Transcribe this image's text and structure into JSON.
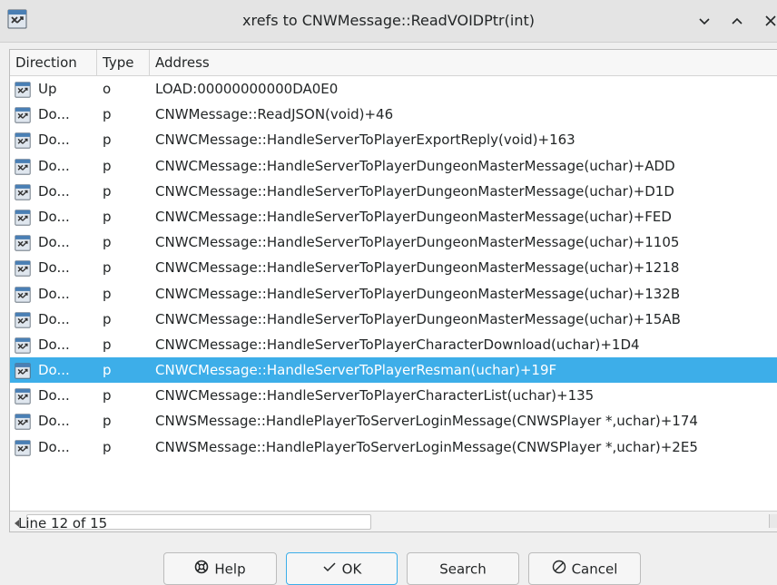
{
  "window": {
    "title": "xrefs to CNWMessage::ReadVOIDPtr(int)"
  },
  "table": {
    "columns": [
      "Direction",
      "Type",
      "Address"
    ],
    "selected_index": 11,
    "rows": [
      {
        "direction": "Up",
        "type": "o",
        "address": "LOAD:00000000000DA0E0"
      },
      {
        "direction": "Do...",
        "type": "p",
        "address": "CNWMessage::ReadJSON(void)+46"
      },
      {
        "direction": "Do...",
        "type": "p",
        "address": "CNWCMessage::HandleServerToPlayerExportReply(void)+163"
      },
      {
        "direction": "Do...",
        "type": "p",
        "address": "CNWCMessage::HandleServerToPlayerDungeonMasterMessage(uchar)+ADD"
      },
      {
        "direction": "Do...",
        "type": "p",
        "address": "CNWCMessage::HandleServerToPlayerDungeonMasterMessage(uchar)+D1D"
      },
      {
        "direction": "Do...",
        "type": "p",
        "address": "CNWCMessage::HandleServerToPlayerDungeonMasterMessage(uchar)+FED"
      },
      {
        "direction": "Do...",
        "type": "p",
        "address": "CNWCMessage::HandleServerToPlayerDungeonMasterMessage(uchar)+1105"
      },
      {
        "direction": "Do...",
        "type": "p",
        "address": "CNWCMessage::HandleServerToPlayerDungeonMasterMessage(uchar)+1218"
      },
      {
        "direction": "Do...",
        "type": "p",
        "address": "CNWCMessage::HandleServerToPlayerDungeonMasterMessage(uchar)+132B"
      },
      {
        "direction": "Do...",
        "type": "p",
        "address": "CNWCMessage::HandleServerToPlayerDungeonMasterMessage(uchar)+15AB"
      },
      {
        "direction": "Do...",
        "type": "p",
        "address": "CNWCMessage::HandleServerToPlayerCharacterDownload(uchar)+1D4"
      },
      {
        "direction": "Do...",
        "type": "p",
        "address": "CNWCMessage::HandleServerToPlayerResman(uchar)+19F"
      },
      {
        "direction": "Do...",
        "type": "p",
        "address": "CNWCMessage::HandleServerToPlayerCharacterList(uchar)+135"
      },
      {
        "direction": "Do...",
        "type": "p",
        "address": "CNWSMessage::HandlePlayerToServerLoginMessage(CNWSPlayer *,uchar)+174"
      },
      {
        "direction": "Do...",
        "type": "p",
        "address": "CNWSMessage::HandlePlayerToServerLoginMessage(CNWSPlayer *,uchar)+2E5"
      }
    ]
  },
  "status": {
    "line_text": "Line 12 of 15"
  },
  "buttons": {
    "help": {
      "label": "Help",
      "icon": "help-icon"
    },
    "ok": {
      "label": "OK",
      "icon": "checkmark-icon"
    },
    "search": {
      "label": "Search"
    },
    "cancel": {
      "label": "Cancel",
      "icon": "cancel-circle-icon"
    }
  },
  "colors": {
    "selection": "#3daee9",
    "background": "#efefef",
    "table_bg": "#ffffff"
  }
}
